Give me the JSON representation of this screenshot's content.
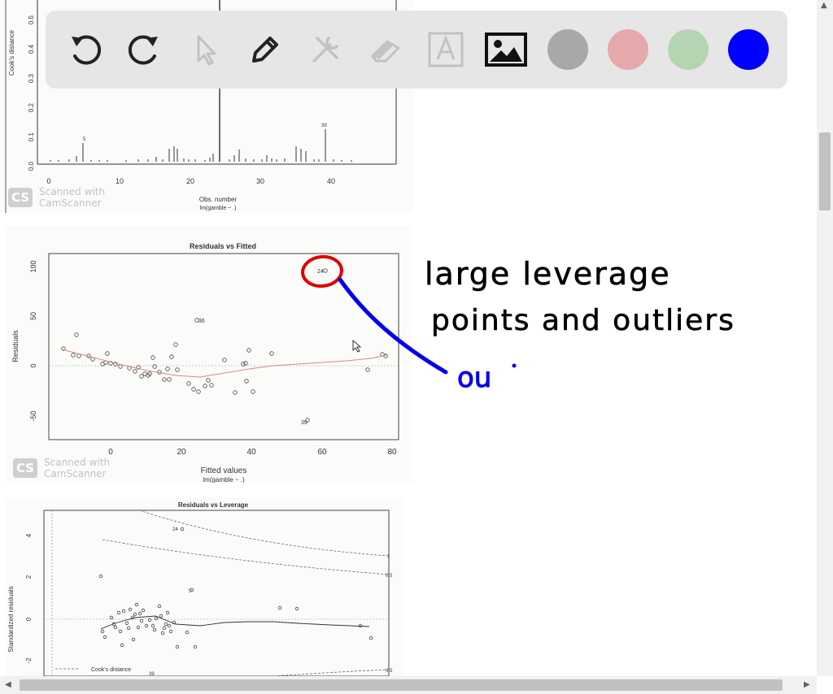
{
  "plot1": {
    "ylabel": "Cook's distance",
    "xlabel": "Obs. number",
    "model": "lm(gamble ~ .)",
    "yticks": [
      "0.0",
      "0.1",
      "0.2",
      "0.3",
      "0.4",
      "0.5"
    ],
    "xticks": [
      "0",
      "10",
      "20",
      "30",
      "40"
    ],
    "point_labels": [
      "5",
      "39"
    ]
  },
  "plot2": {
    "title": "Residuals vs Fitted",
    "ylabel": "Residuals",
    "xlabel": "Fitted values",
    "model": "lm(gamble ~ .)",
    "yticks": [
      "100",
      "50",
      "0",
      "-50"
    ],
    "xticks": [
      "0",
      "20",
      "40",
      "60",
      "80"
    ],
    "point_labels": [
      "24",
      "36",
      "39"
    ]
  },
  "plot3": {
    "title": "Residuals vs Leverage",
    "ylabel": "Standardized residuals",
    "legend": "Cook's distance",
    "yticks": [
      "4",
      "2",
      "0",
      "-2"
    ],
    "contour_labels": [
      "1",
      "0.5",
      "0.5"
    ],
    "point_labels": [
      "24",
      "5",
      "39"
    ]
  },
  "watermark": {
    "logo": "CS",
    "line1": "Scanned with",
    "line2": "CamScanner"
  },
  "annotation": {
    "line1": "large leverage",
    "line2": "points and outliers",
    "fragment": "ou"
  },
  "toolbar": {
    "tools": [
      "undo-icon",
      "redo-icon",
      "pointer-icon",
      "pen-icon",
      "tools-icon",
      "eraser-icon",
      "text-icon",
      "image-icon"
    ],
    "colors": [
      "#a8a8a8",
      "#e5a8ab",
      "#b5d4b1",
      "#0000ff"
    ]
  },
  "scrollbar": {
    "up": "▲",
    "left": "◀",
    "right": "▶"
  }
}
